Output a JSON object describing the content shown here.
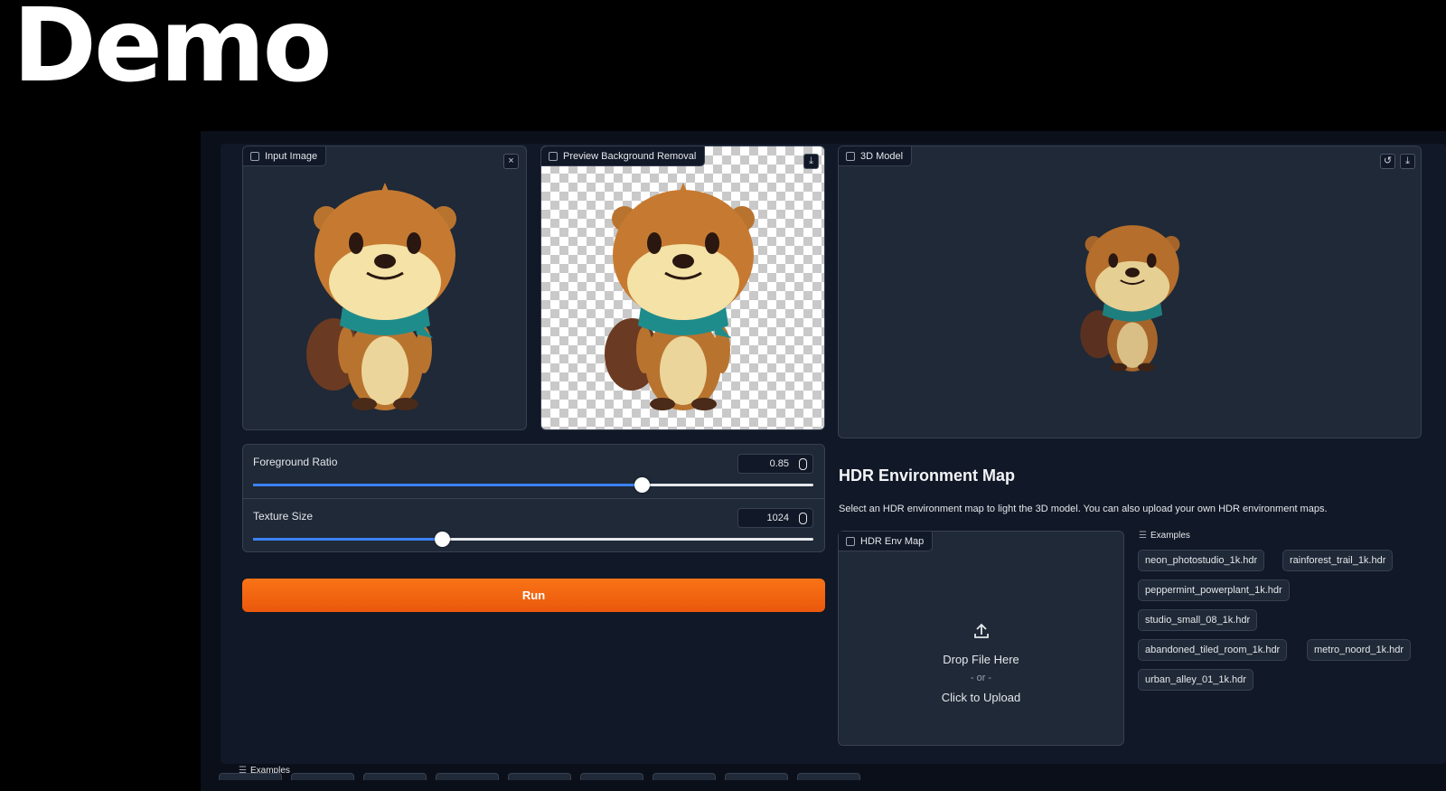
{
  "slide_title": "Demo",
  "input_panel": {
    "label": "Input Image",
    "close": "×"
  },
  "preview_panel": {
    "label": "Preview Background Removal",
    "download": "⤓"
  },
  "model_panel": {
    "label": "3D Model",
    "reset": "↺",
    "download": "⤓"
  },
  "sliders": [
    {
      "label": "Foreground Ratio",
      "value": "0.85",
      "fraction": 0.693
    },
    {
      "label": "Texture Size",
      "value": "1024",
      "fraction": 0.337
    }
  ],
  "run_button": "Run",
  "hdr": {
    "title": "HDR Environment Map",
    "description": "Select an HDR environment map to light the 3D model. You can also upload your own HDR environment maps.",
    "upload_label": "HDR Env Map",
    "drop_text": "Drop File Here",
    "or_text": "- or -",
    "click_text": "Click to Upload",
    "examples_label": "Examples",
    "examples": [
      "neon_photostudio_1k.hdr",
      "rainforest_trail_1k.hdr",
      "peppermint_powerplant_1k.hdr",
      "studio_small_08_1k.hdr",
      "abandoned_tiled_room_1k.hdr",
      "metro_noord_1k.hdr",
      "urban_alley_01_1k.hdr"
    ]
  },
  "bottom_examples_label": "Examples",
  "colors": {
    "accent": "#3b82f6",
    "run": "#ea580c",
    "background": "#0b0f19",
    "panel": "#1f2937"
  },
  "icons": [
    "image-icon",
    "close-icon",
    "download-icon",
    "reset-icon",
    "file-icon",
    "upload-icon",
    "list-icon"
  ]
}
